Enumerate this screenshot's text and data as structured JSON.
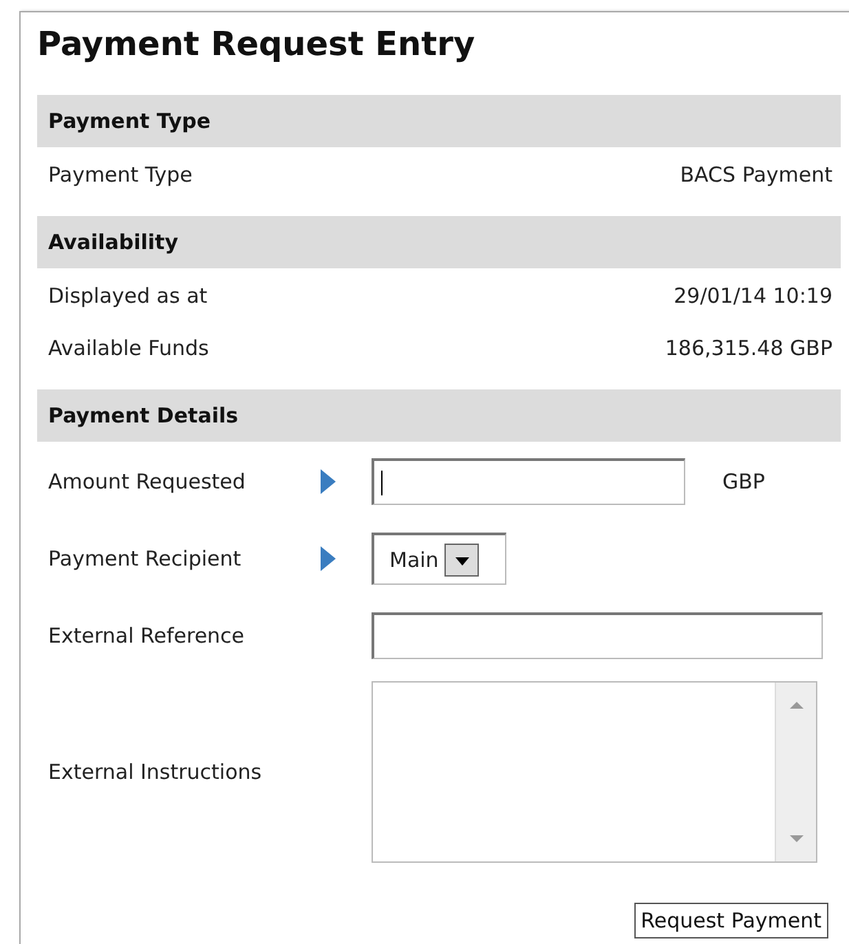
{
  "title": "Payment Request Entry",
  "sections": [
    {
      "heading": "Payment Type",
      "rows": [
        {
          "label": "Payment Type",
          "value": "BACS Payment"
        }
      ]
    },
    {
      "heading": "Availability",
      "rows": [
        {
          "label": "Displayed as at",
          "value": "29/01/14 10:19"
        },
        {
          "label": "Available Funds",
          "value": "186,315.48 GBP"
        }
      ]
    },
    {
      "heading": "Payment Details",
      "fields": [
        {
          "kind": "text",
          "label": "Amount Requested",
          "required": true,
          "suffix": "GBP",
          "focused": true
        },
        {
          "kind": "select",
          "label": "Payment Recipient",
          "required": true,
          "value": "Main"
        },
        {
          "kind": "wide-text",
          "label": "External Reference",
          "required": false
        },
        {
          "kind": "textarea",
          "label": "External Instructions",
          "required": false
        }
      ]
    }
  ],
  "button": "Request Payment"
}
